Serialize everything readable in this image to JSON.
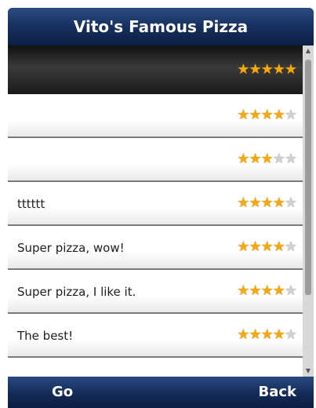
{
  "header": {
    "title": "Vito's Famous Pizza"
  },
  "reviews": [
    {
      "text": "",
      "rating": 5
    },
    {
      "text": "",
      "rating": 4
    },
    {
      "text": "",
      "rating": 3
    },
    {
      "text": "tttttt",
      "rating": 4
    },
    {
      "text": "Super pizza, wow!",
      "rating": 4
    },
    {
      "text": "Super pizza, I like it.",
      "rating": 4
    },
    {
      "text": "The best!",
      "rating": 4
    }
  ],
  "rating_max": 5,
  "selected_index": 0,
  "softkeys": {
    "left": "Go",
    "right": "Back"
  },
  "colors": {
    "star_on": "#f5a90f",
    "star_off": "#cfcfcf",
    "bar": "#1a3566"
  }
}
